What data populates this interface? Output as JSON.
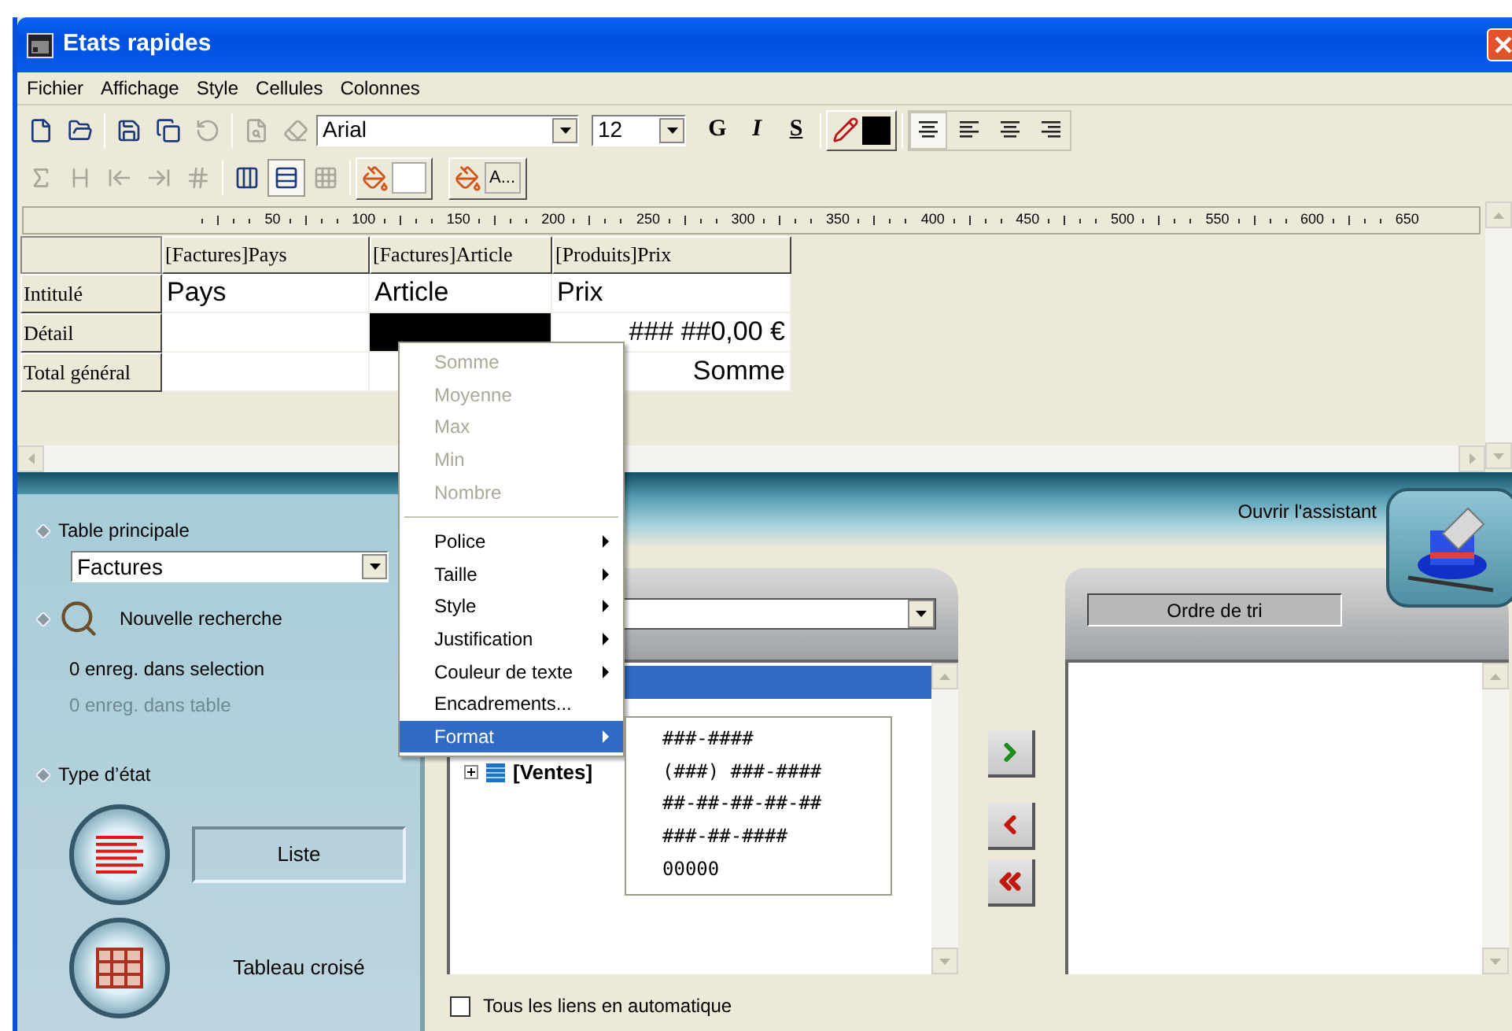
{
  "window": {
    "title": "Etats rapides"
  },
  "menu_bar": [
    "Fichier",
    "Affichage",
    "Style",
    "Cellules",
    "Colonnes"
  ],
  "toolbar": {
    "buttons": [
      {
        "kind": "new",
        "disabled": false
      },
      {
        "kind": "open",
        "disabled": false
      },
      {
        "kind": "save",
        "disabled": false
      },
      {
        "kind": "saveall",
        "disabled": false
      },
      {
        "kind": "revert",
        "disabled": true
      },
      {
        "kind": "preview",
        "disabled": true
      },
      {
        "kind": "erase",
        "disabled": true
      }
    ],
    "font": "Arial",
    "size": "12",
    "styles": [
      "G",
      "I",
      "S"
    ],
    "align": [
      {
        "kind": "center",
        "selected": true
      },
      {
        "kind": "left",
        "selected": false
      },
      {
        "kind": "center",
        "selected": false
      },
      {
        "kind": "right",
        "selected": false
      }
    ]
  },
  "toolbar2": {
    "buttons": [
      {
        "kind": "sum",
        "disabled": true
      },
      {
        "kind": "total",
        "disabled": true
      },
      {
        "kind": "addleft",
        "disabled": true
      },
      {
        "kind": "addright",
        "disabled": true
      },
      {
        "kind": "count",
        "disabled": true
      }
    ],
    "views": [
      {
        "kind": "columns",
        "selected": false,
        "disabled": false
      },
      {
        "kind": "rows",
        "selected": true,
        "disabled": false
      },
      {
        "kind": "grid",
        "selected": false,
        "disabled": true
      }
    ],
    "fill_text": "A..."
  },
  "ruler": [
    "50",
    "100",
    "150",
    "200",
    "250",
    "300",
    "350",
    "400",
    "450",
    "500",
    "550",
    "600",
    "650"
  ],
  "report": {
    "columns": [
      "[Factures]Pays",
      "[Factures]Article",
      "[Produits]Prix"
    ],
    "rows": [
      {
        "label": "Intitulé",
        "cells": [
          {
            "text": "Pays",
            "selected": false
          },
          {
            "text": "Article",
            "selected": false
          },
          {
            "text": "Prix",
            "selected": false
          }
        ]
      },
      {
        "label": "Détail",
        "cells": [
          {
            "selected": false
          },
          {
            "selected": true
          },
          {
            "text": "### ##0,00 €",
            "selected": false
          }
        ]
      },
      {
        "label": "Total général",
        "cells": [
          {
            "selected": false
          },
          {
            "selected": false
          },
          {
            "text": "Somme",
            "selected": false
          }
        ]
      }
    ]
  },
  "left_panel": {
    "table_label": "Table principale",
    "table_value": "Factures",
    "search": "Nouvelle recherche",
    "counts": [
      {
        "text": "0 enreg. dans selection",
        "disabled": false
      },
      {
        "text": "0 enreg. dans table",
        "disabled": true
      }
    ],
    "type_label": "Type d’état",
    "types": [
      {
        "kind": "list",
        "label": "Liste",
        "selected": true
      },
      {
        "kind": "crosstab",
        "label": "Tableau croisé",
        "selected": false
      }
    ]
  },
  "assistant": "Ouvrir l'assistant",
  "tree": [
    {
      "selected": true
    },
    {
      "label": "[Ventes]",
      "selected": false,
      "expanded": false
    }
  ],
  "sort_panel": {
    "title": "Ordre de tri"
  },
  "auto_links": {
    "label": "Tous les liens en automatique",
    "checked": false
  },
  "context_menu": [
    {
      "kind": "item",
      "label": "Somme",
      "disabled": true,
      "submenu": false,
      "selected": false
    },
    {
      "kind": "item",
      "label": "Moyenne",
      "disabled": true,
      "submenu": false,
      "selected": false
    },
    {
      "kind": "item",
      "label": "Max",
      "disabled": true,
      "submenu": false,
      "selected": false
    },
    {
      "kind": "item",
      "label": "Min",
      "disabled": true,
      "submenu": false,
      "selected": false
    },
    {
      "kind": "item",
      "label": "Nombre",
      "disabled": true,
      "submenu": false,
      "selected": false
    },
    {
      "kind": "separator"
    },
    {
      "kind": "item",
      "label": "Police",
      "disabled": false,
      "submenu": true,
      "selected": false
    },
    {
      "kind": "item",
      "label": "Taille",
      "disabled": false,
      "submenu": true,
      "selected": false
    },
    {
      "kind": "item",
      "label": "Style",
      "disabled": false,
      "submenu": true,
      "selected": false
    },
    {
      "kind": "item",
      "label": "Justification",
      "disabled": false,
      "submenu": true,
      "selected": false
    },
    {
      "kind": "item",
      "label": "Couleur de texte",
      "disabled": false,
      "submenu": true,
      "selected": false
    },
    {
      "kind": "item",
      "label": "Encadrements...",
      "disabled": false,
      "submenu": false,
      "selected": false
    },
    {
      "kind": "item",
      "label": "Format",
      "disabled": false,
      "submenu": true,
      "selected": true
    }
  ],
  "format_submenu": [
    "###-####",
    "(###) ###-####",
    "##-##-##-##-##",
    "###-##-####",
    "00000"
  ]
}
